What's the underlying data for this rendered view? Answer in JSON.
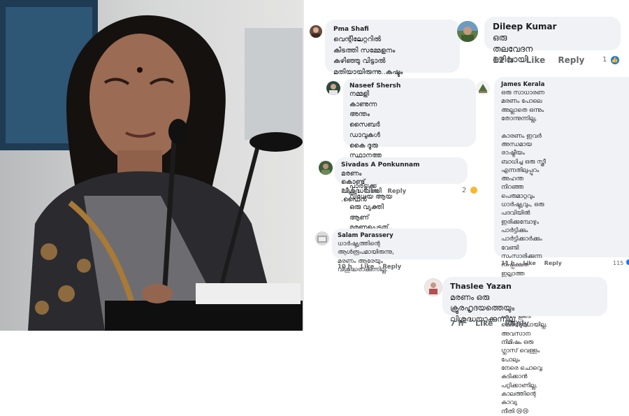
{
  "comments": {
    "pma_shafi": {
      "name": "Pma Shafi",
      "text": "വെന്റിലേറ്ററിൽ കിടത്തി സമ്മേളനം\nകഴിഞ്ഞു വിട്ടാൽ\nമതിയായിരുന്നു..കഷ്ടം"
    },
    "dileep_kumar": {
      "name": "Dileep Kumar",
      "text": "ഒരു തലവേദന ഒഴിവായി",
      "time": "12 h",
      "like": "Like",
      "reply": "Reply",
      "reaction_count": "1"
    },
    "naseef_shersh": {
      "name": "Naseef Shersh",
      "text": "നമ്മളി കാണുന്ന അന്തം സൈബർ\nഡാവുകൾ കൈ ദൂരു സ്ഥാനത്തു\nകാണേണ്ട അളവിൽ പാർട്ടിക്ക്\nവിധേയ ആയ ഒരു വ്യക്തി ആണ്\nമരണപ്പെട്ടത്.."
    },
    "sivadas": {
      "name": "Sivadas A Ponkunnam",
      "text": "മരണം കൊണ്ട് വിശുദ്ധയായി .ഫൈൻ",
      "time": "12 h",
      "like": "Like",
      "reply": "Reply",
      "reaction_count": "2"
    },
    "james_kerala": {
      "name": "James Kerala",
      "text": "ഒരു സാധാരണ മരണം പോലെ\nഅല്ലാതെ ഒന്നും തോന്നുന്നില്ല,\n\nകാരണം ഇവർ അന്ധമായ രാഷ്ട്രീയം\nബാധിച്ച ഒരു സ്ത്രീ എന്നതിലുപ്പുറം\nഅഹന്ത നിറഞ്ഞ പെരുമാറ്റവും\nധാർഷ്ട്യവും, ഒരു പദവിയിൽ\nഇരിക്കുമ്പോഴും പാർട്ടിക്കും\nപാർട്ടിക്കാർക്കും വേണ്ടി\nസംസാരിക്കുന്ന നിഷ്പക്ഷത ഇല്ലാത്ത\nഒരു സ്ത്രീ 😖😖😖\n\nഎന്തൊക്കെ നേടിയാലും ഒന്നും കൂടെ\nകൊണ്ടുപോയില്ല.  അവസാന\nനിമിഷം ഒരു ഗ്ലാസ് വെള്ളം പോലും\nനേരെ ചൊവ്വെ കുടിക്കാൻ\nപറ്റിക്കാണില്ല. കാലത്തിന്റെ കാവ്യ\nനീതി 😢😢",
      "time": "11 h",
      "like": "Like",
      "reply": "Reply",
      "reaction_count": "115"
    },
    "salam_parassery": {
      "name": "Salam Parassery",
      "text": "ധാർഷ്ട്യത്തിന്റെ ആൾരൂപമായിരുന്നു,\nമരണം ആരേയും വിശുദ്ധരാക്കുന്നില്ല.",
      "time": "10 h",
      "like": "Like",
      "reply": "Reply"
    },
    "thaslee_yazan": {
      "name": "Thaslee Yazan",
      "text": "മരണം ഒരു ക്രൂരഹൃദയത്തെയും\nവിശുദ്ധയാക്കുന്നില്ല...",
      "time": "7 h",
      "like": "Like",
      "reply": "Reply"
    }
  },
  "colors": {
    "bubble": "#f0f2f5",
    "meta_text": "#65676b",
    "name_text": "#1c1e21",
    "like_blue": "#1877f2",
    "haha_yellow": "#f7b928"
  }
}
